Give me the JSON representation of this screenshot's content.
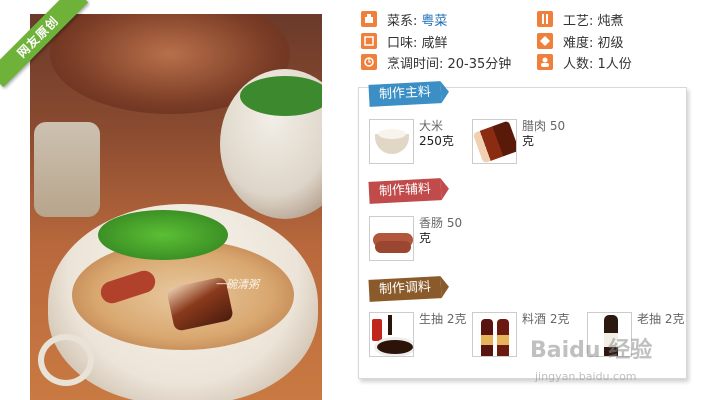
{
  "badge": "网友原创",
  "photo_watermark": "一碗清粥",
  "info": {
    "cuisine_label": "菜系:",
    "cuisine_value": "粤菜",
    "technique": "工艺: 炖煮",
    "taste": "口味: 咸鲜",
    "difficulty": "难度: 初级",
    "cook_time": "烹调时间: 20-35分钟",
    "servings": "人数: 1人份"
  },
  "sections": {
    "main": {
      "title": "制作主料",
      "items": [
        {
          "name": "大米",
          "amount": "250克"
        },
        {
          "name": "腊肉 50",
          "amount": "克"
        }
      ]
    },
    "aux": {
      "title": "制作辅料",
      "items": [
        {
          "name": "香肠 50",
          "amount": "克"
        }
      ]
    },
    "seasoning": {
      "title": "制作调料",
      "items": [
        {
          "name": "生抽 2克"
        },
        {
          "name": "料酒 2克"
        },
        {
          "name": "老抽 2克"
        }
      ]
    }
  },
  "watermark": {
    "brand": "Baidu 经验",
    "site": "jingyan.baidu.com"
  },
  "colors": {
    "accent_orange": "#ef7f3a",
    "link_blue": "#1b6fb5",
    "tag_blue": "#3b8fc4",
    "tag_red": "#c14a4a",
    "tag_brown": "#8a5a2b",
    "badge_green": "#6fb23a"
  },
  "icons": [
    "cuisine-icon",
    "taste-icon",
    "clock-icon",
    "technique-icon",
    "difficulty-icon",
    "servings-icon"
  ]
}
